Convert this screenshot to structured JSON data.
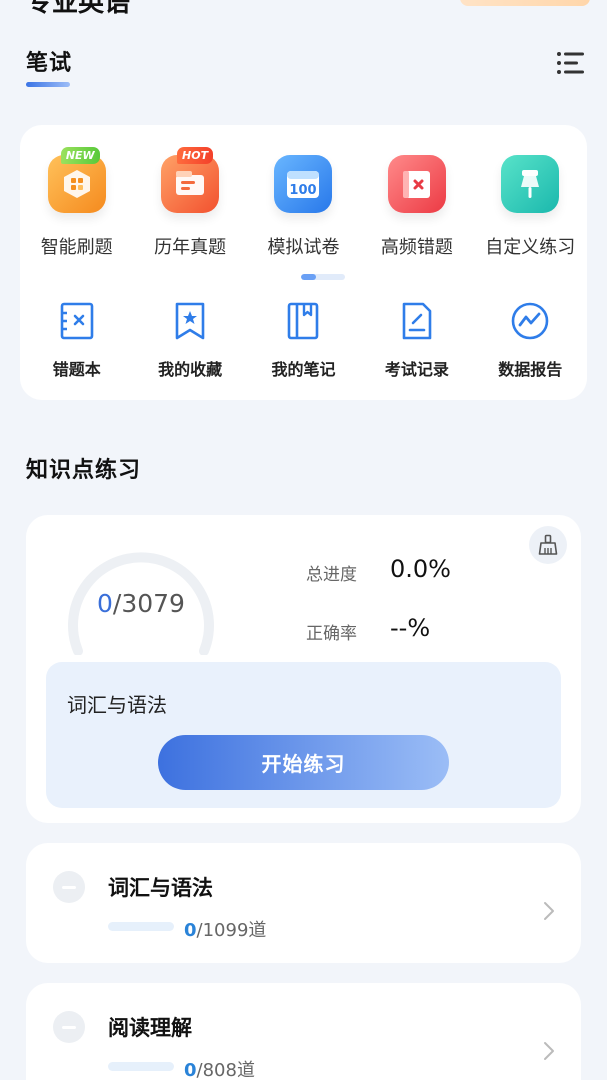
{
  "top_banner": {
    "title_fragment": "专业英语"
  },
  "section": {
    "title": "笔试"
  },
  "features": [
    {
      "label": "智能刷题",
      "icon": "cube-icon",
      "color": "#f9a436",
      "tag": "NEW"
    },
    {
      "label": "历年真题",
      "icon": "document-icon",
      "color": "#f9753f",
      "tag": "HOT"
    },
    {
      "label": "模拟试卷",
      "icon": "calendar-100-icon",
      "color": "#3b8fef",
      "tag": ""
    },
    {
      "label": "高频错题",
      "icon": "error-book-icon",
      "color": "#f2565a",
      "tag": ""
    },
    {
      "label": "自定义练习",
      "icon": "pushpin-icon",
      "color": "#2fcdb7",
      "tag": ""
    }
  ],
  "feature_pager": {
    "fill": 0.33
  },
  "tools": [
    {
      "label": "错题本",
      "icon": "wrong-book-icon"
    },
    {
      "label": "我的收藏",
      "icon": "bookmark-icon"
    },
    {
      "label": "我的笔记",
      "icon": "notebook-icon"
    },
    {
      "label": "考试记录",
      "icon": "record-icon"
    },
    {
      "label": "数据报告",
      "icon": "chart-report-icon"
    }
  ],
  "knowledge": {
    "title": "知识点练习",
    "progress": {
      "done": "0",
      "total": "/3079",
      "total_label": "总进度",
      "total_value": "0.0%",
      "accuracy_label": "正确率",
      "accuracy_value": "--%",
      "fraction": 0
    },
    "current_topic": "词汇与语法",
    "start_button": "开始练习",
    "chapters": [
      {
        "title": "词汇与语法",
        "done": "0",
        "total": "/1099道",
        "fraction": 0
      },
      {
        "title": "阅读理解",
        "done": "0",
        "total": "/808道",
        "fraction": 0
      }
    ]
  },
  "colors": {
    "accent": "#3d71df",
    "background": "#f2f5fa",
    "card": "#ffffff",
    "progress_blue": "#2a83d8"
  }
}
